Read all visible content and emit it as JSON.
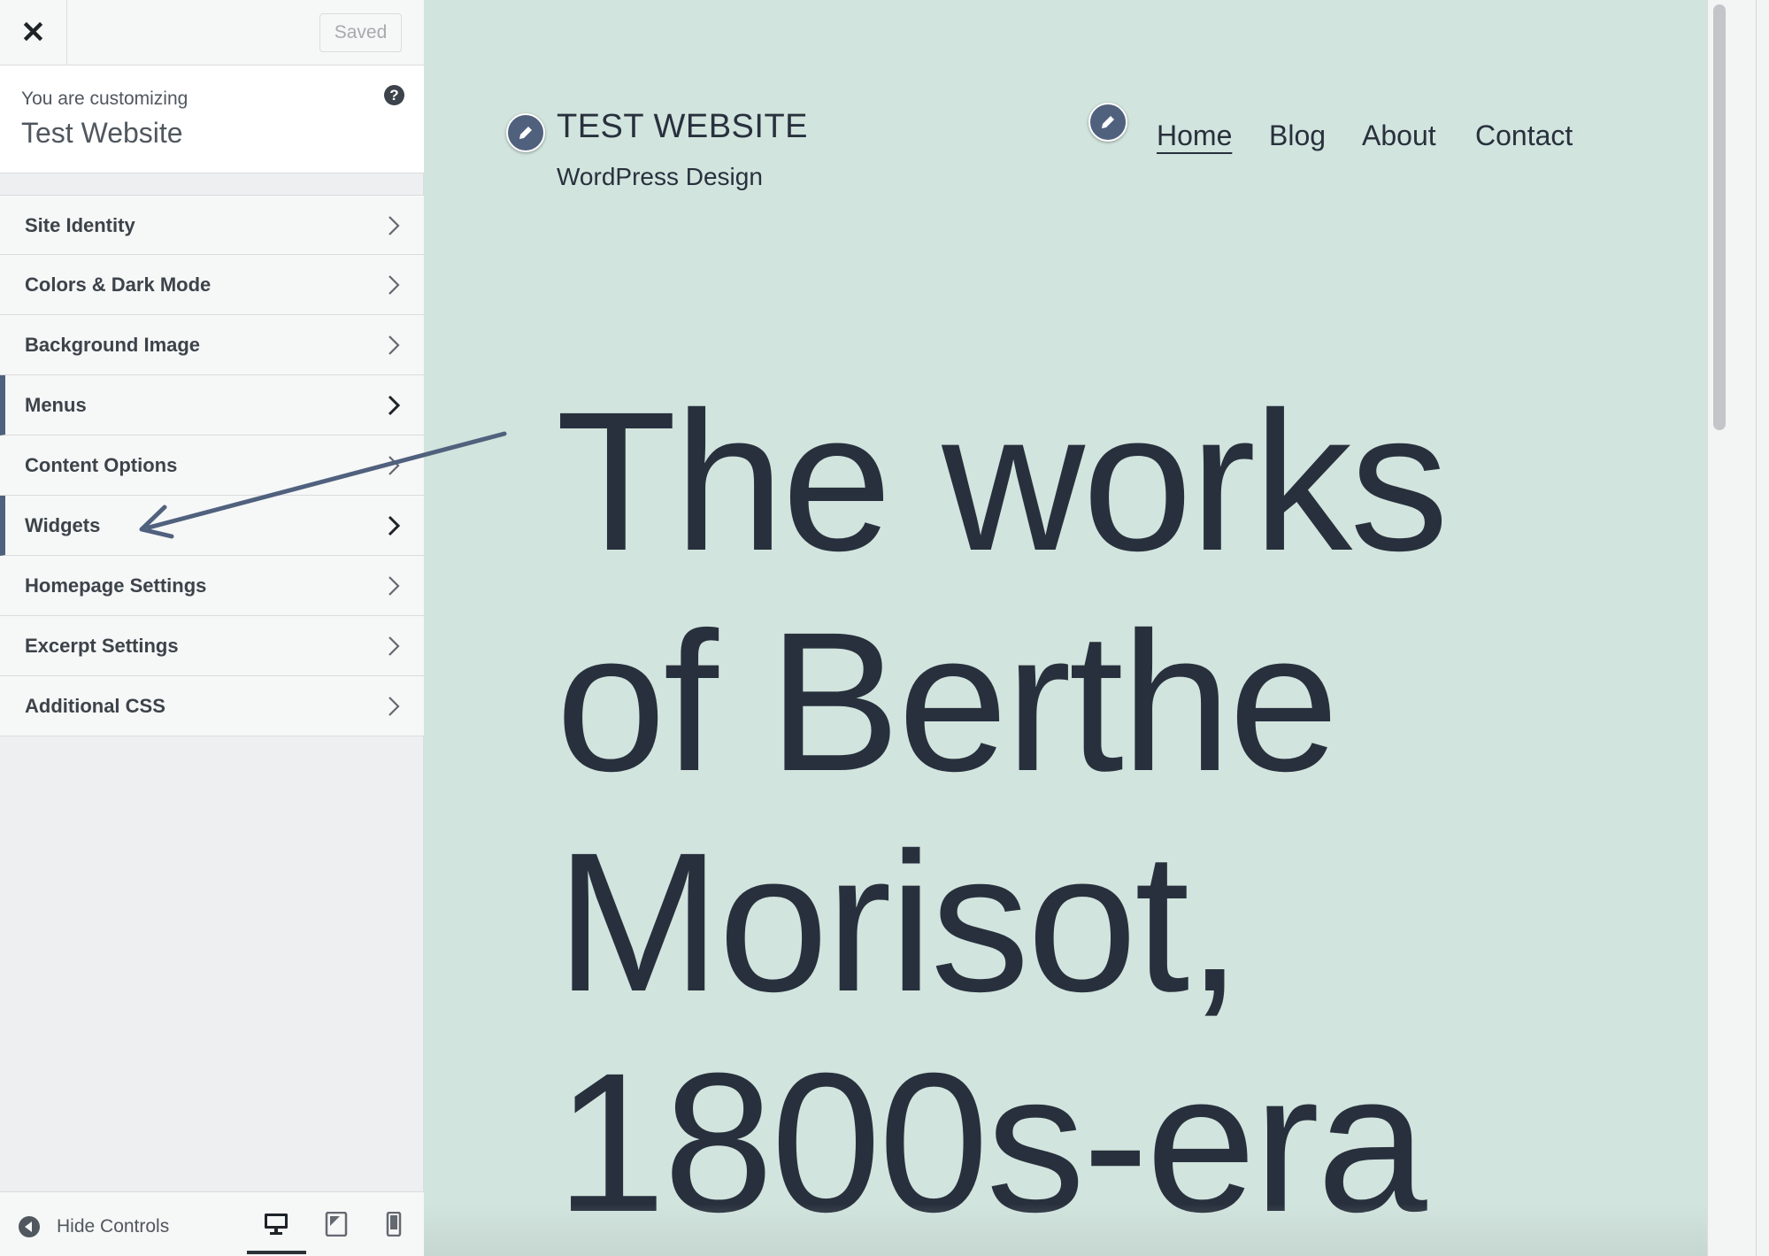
{
  "topbar": {
    "close_icon": "close-icon",
    "saved_label": "Saved"
  },
  "info": {
    "label": "You are customizing",
    "site_name": "Test Website",
    "help_icon": "?"
  },
  "menu": {
    "items": [
      {
        "label": "Site Identity"
      },
      {
        "label": "Colors & Dark Mode"
      },
      {
        "label": "Background Image"
      },
      {
        "label": "Menus"
      },
      {
        "label": "Content Options"
      },
      {
        "label": "Widgets"
      },
      {
        "label": "Homepage Settings"
      },
      {
        "label": "Excerpt Settings"
      },
      {
        "label": "Additional CSS"
      }
    ]
  },
  "footer": {
    "hide_label": "Hide Controls",
    "devices": [
      "desktop-icon",
      "tablet-icon",
      "mobile-icon"
    ]
  },
  "preview": {
    "site_title": "TEST WEBSITE",
    "tagline": "WordPress Design",
    "nav": [
      "Home",
      "Blog",
      "About",
      "Contact"
    ],
    "hero_lines": [
      "The works",
      "of Berthe",
      "Morisot,",
      "1800s-era"
    ]
  },
  "colors": {
    "preview_bg": "#d1e4dd",
    "text": "#28303d",
    "accent": "#50617e"
  }
}
